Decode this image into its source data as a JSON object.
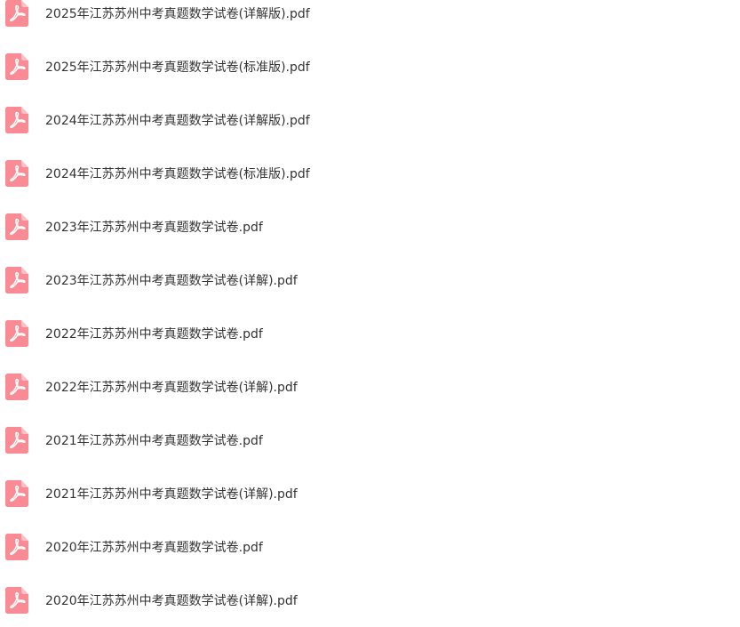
{
  "file_list": {
    "icon_name": "pdf-file-icon",
    "icon_color": "#FA8A93",
    "items": [
      {
        "name": "2025年江苏苏州中考真题数学试卷(详解版).pdf"
      },
      {
        "name": "2025年江苏苏州中考真题数学试卷(标准版).pdf"
      },
      {
        "name": "2024年江苏苏州中考真题数学试卷(详解版).pdf"
      },
      {
        "name": "2024年江苏苏州中考真题数学试卷(标准版).pdf"
      },
      {
        "name": "2023年江苏苏州中考真题数学试卷.pdf"
      },
      {
        "name": "2023年江苏苏州中考真题数学试卷(详解).pdf"
      },
      {
        "name": "2022年江苏苏州中考真题数学试卷.pdf"
      },
      {
        "name": "2022年江苏苏州中考真题数学试卷(详解).pdf"
      },
      {
        "name": "2021年江苏苏州中考真题数学试卷.pdf"
      },
      {
        "name": "2021年江苏苏州中考真题数学试卷(详解).pdf"
      },
      {
        "name": "2020年江苏苏州中考真题数学试卷.pdf"
      },
      {
        "name": "2020年江苏苏州中考真题数学试卷(详解).pdf"
      }
    ]
  }
}
